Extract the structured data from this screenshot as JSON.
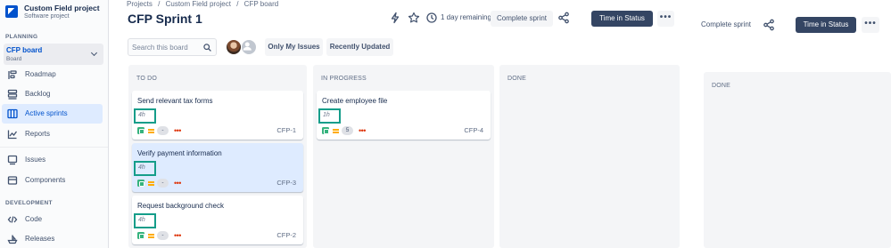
{
  "project": {
    "name": "Custom Field project",
    "type": "Software project"
  },
  "sidebar": {
    "planning_label": "PLANNING",
    "board": {
      "name": "CFP board",
      "type": "Board"
    },
    "items": [
      {
        "label": "Roadmap",
        "icon": "roadmap-icon"
      },
      {
        "label": "Backlog",
        "icon": "backlog-icon"
      },
      {
        "label": "Active sprints",
        "icon": "board-columns-icon",
        "active": true
      },
      {
        "label": "Reports",
        "icon": "chart-line-icon"
      },
      {
        "label": "Issues",
        "icon": "issues-icon"
      },
      {
        "label": "Components",
        "icon": "components-icon"
      }
    ],
    "development_label": "DEVELOPMENT",
    "dev_items": [
      {
        "label": "Code",
        "icon": "code-icon"
      },
      {
        "label": "Releases",
        "icon": "ship-icon"
      }
    ]
  },
  "breadcrumb": [
    "Projects",
    "/",
    "Custom Field project",
    "/",
    "CFP board"
  ],
  "header": {
    "title": "CFP Sprint 1",
    "days_remaining": "1 day remaining",
    "complete_sprint": "Complete sprint",
    "time_in_status": "Time in Status",
    "more": "•••"
  },
  "filters": {
    "search_placeholder": "Search this board",
    "only_my_issues": "Only My Issues",
    "recently_updated": "Recently Updated"
  },
  "columns": [
    {
      "title": "TO DO",
      "cards": [
        {
          "title": "Send relevant tax forms",
          "estimate": "4h",
          "points": "-",
          "key": "CFP-1",
          "selected": false
        },
        {
          "title": "Verify payment information",
          "estimate": "4h",
          "points": "-",
          "key": "CFP-3",
          "selected": true
        },
        {
          "title": "Request background check",
          "estimate": "4h",
          "points": "-",
          "key": "CFP-2",
          "selected": false
        }
      ]
    },
    {
      "title": "IN PROGRESS",
      "cards": [
        {
          "title": "Create employee file",
          "estimate": "1h",
          "points": "5",
          "key": "CFP-4",
          "selected": false
        }
      ]
    },
    {
      "title": "DONE",
      "cards": []
    }
  ],
  "duplicate_panel": {
    "complete_sprint": "Complete sprint",
    "time_in_status": "Time in Status",
    "more": "•••",
    "done_title": "DONE"
  },
  "colors": {
    "accent": "#0052cc",
    "dark_button": "#344563",
    "estimate_highlight": "#159d8a",
    "story": "#36b37e",
    "priority_medium": "#ffab00",
    "priority_dots": "#de350b"
  }
}
